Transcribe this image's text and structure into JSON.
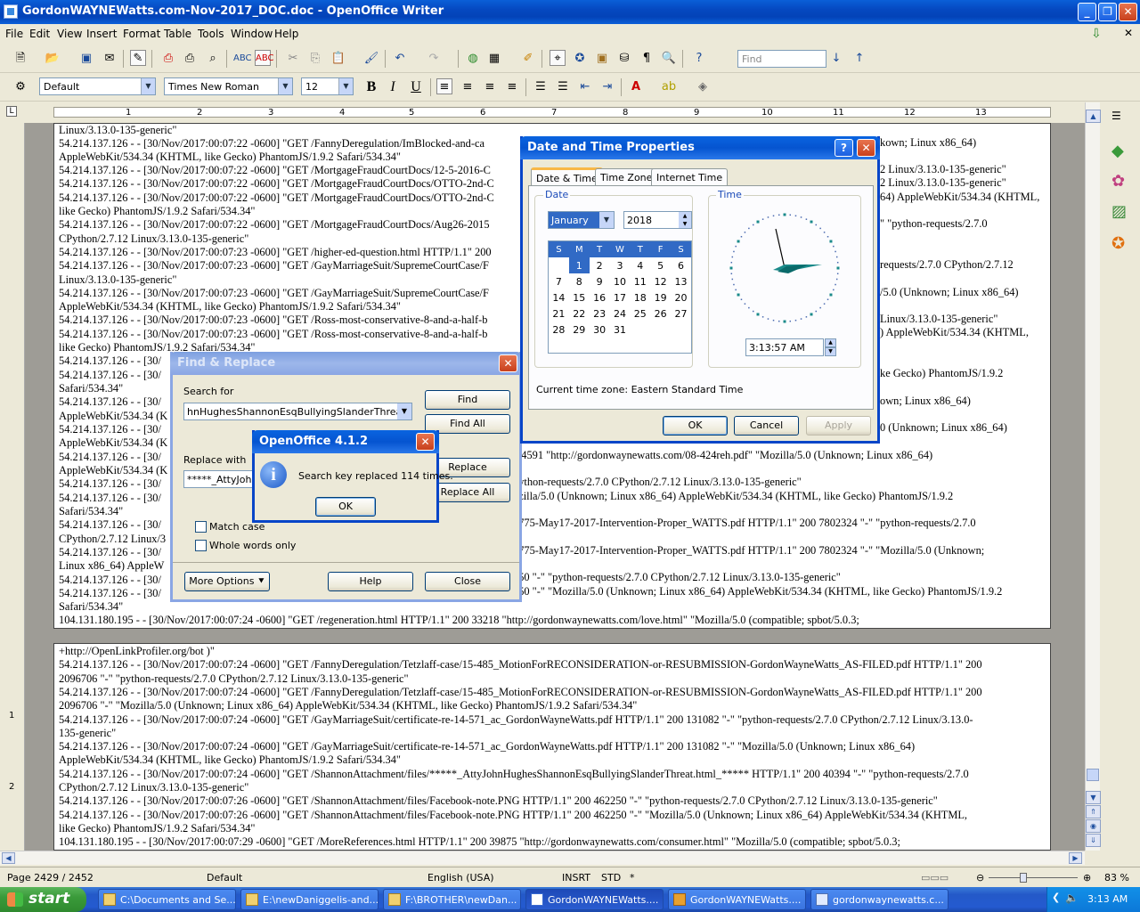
{
  "window": {
    "title": "GordonWAYNEWatts.com-Nov-2017_DOC.doc - OpenOffice Writer"
  },
  "menu": [
    "File",
    "Edit",
    "View",
    "Insert",
    "Format",
    "Table",
    "Tools",
    "Window",
    "Help"
  ],
  "toolbar": {
    "find_placeholder": "Find"
  },
  "format_bar": {
    "style": "Default",
    "font": "Times New Roman",
    "size": "12",
    "bold": "B",
    "italic": "I",
    "underline": "U"
  },
  "ruler": {
    "numbers": [
      "1",
      "2",
      "3",
      "4",
      "5",
      "6",
      "7",
      "8",
      "9",
      "10",
      "11",
      "12",
      "13"
    ]
  },
  "document": {
    "page1_lines": [
      "Linux/3.13.0-135-generic\"",
      "54.214.137.126 - - [30/Nov/2017:00:07:22 -0600] \"GET /FannyDeregulation/ImBlocked-and-ca",
      "AppleWebKit/534.34 (KHTML, like Gecko) PhantomJS/1.9.2 Safari/534.34\"",
      "54.214.137.126 - - [30/Nov/2017:00:07:22 -0600] \"GET /MortgageFraudCourtDocs/12-5-2016-C",
      "54.214.137.126 - - [30/Nov/2017:00:07:22 -0600] \"GET /MortgageFraudCourtDocs/OTTO-2nd-C",
      "54.214.137.126 - - [30/Nov/2017:00:07:22 -0600] \"GET /MortgageFraudCourtDocs/OTTO-2nd-C",
      "like Gecko) PhantomJS/1.9.2 Safari/534.34\"",
      "54.214.137.126 - - [30/Nov/2017:00:07:22 -0600] \"GET /MortgageFraudCourtDocs/Aug26-2015",
      "CPython/2.7.12 Linux/3.13.0-135-generic\"",
      "54.214.137.126 - - [30/Nov/2017:00:07:23 -0600] \"GET /higher-ed-question.html HTTP/1.1\" 200",
      "54.214.137.126 - - [30/Nov/2017:00:07:23 -0600] \"GET /GayMarriageSuit/SupremeCourtCase/F",
      "Linux/3.13.0-135-generic\"",
      "54.214.137.126 - - [30/Nov/2017:00:07:23 -0600] \"GET /GayMarriageSuit/SupremeCourtCase/F",
      "AppleWebKit/534.34 (KHTML, like Gecko) PhantomJS/1.9.2 Safari/534.34\"",
      "54.214.137.126 - - [30/Nov/2017:00:07:23 -0600] \"GET /Ross-most-conservative-8-and-a-half-b",
      "54.214.137.126 - - [30/Nov/2017:00:07:23 -0600] \"GET /Ross-most-conservative-8-and-a-half-b",
      "like Gecko) PhantomJS/1.9.2 Safari/534.34\"",
      "54.214.137.126 - - [30/",
      "54.214.137.126 - - [30/",
      "Safari/534.34\"",
      "54.214.137.126 - - [30/",
      "AppleWebKit/534.34 (K",
      "54.214.137.126 - - [30/",
      "AppleWebKit/534.34 (K",
      "54.214.137.126 - - [30/",
      "AppleWebKit/534.34 (K",
      "54.214.137.126 - - [30/",
      "54.214.137.126 - - [30/",
      "Safari/534.34\"",
      "54.214.137.126 - - [30/",
      "CPython/2.7.12 Linux/3",
      "54.214.137.126 - - [30/",
      "Linux x86_64) AppleW",
      "54.214.137.126 - - [30/",
      "54.214.137.126 - - [30/",
      "Safari/534.34\"",
      "104.131.180.195 - - [30/Nov/2017:00:07:24 -0600] \"GET /regeneration.html HTTP/1.1\" 200 33218 \"http://gordonwaynewatts.com/love.html\" \"Mozilla/5.0 (compatible; spbot/5.0.3;"
    ],
    "page1_right": [
      [
        "kown; Linux x86_64)",
        160
      ],
      [
        "2 Linux/3.13.0-135-generic\"",
        190
      ],
      [
        "2 Linux/3.13.0-135-generic\"",
        205
      ],
      [
        "64) AppleWebKit/534.34 (KHTML,",
        221
      ],
      [
        "\" \"python-requests/2.7.0",
        251
      ],
      [
        "requests/2.7.0 CPython/2.7.12",
        297
      ],
      [
        "/5.0 (Unknown; Linux x86_64)",
        328
      ],
      [
        "Linux/3.13.0-135-generic\"",
        358
      ],
      [
        ") AppleWebKit/534.34 (KHTML,",
        373
      ],
      [
        "ke Gecko) PhantomJS/1.9.2",
        419
      ],
      [
        "own; Linux x86_64)",
        450
      ],
      [
        "0 (Unknown; Linux x86_64)",
        480
      ]
    ],
    "page1_mid": [
      [
        "0 4591 \"http://gordonwaynewatts.com/08-424reh.pdf\" \"Mozilla/5.0 (Unknown; Linux x86_64)",
        511
      ],
      [
        "python-requests/2.7.0 CPython/2.7.12 Linux/3.13.0-135-generic\"",
        541
      ],
      [
        "ozilla/5.0 (Unknown; Linux x86_64) AppleWebKit/534.34 (KHTML, like Gecko) PhantomJS/1.9.2",
        557
      ],
      [
        "0775-May17-2017-Intervention-Proper_WATTS.pdf HTTP/1.1\" 200 7802324 \"-\" \"python-requests/2.7.0",
        587
      ],
      [
        "0775-May17-2017-Intervention-Proper_WATTS.pdf HTTP/1.1\" 200 7802324 \"-\" \"Mozilla/5.0 (Unknown;",
        618
      ],
      [
        "250 \"-\" \"python-requests/2.7.0 CPython/2.7.12 Linux/3.13.0-135-generic\"",
        648
      ],
      [
        "250 \"-\" \"Mozilla/5.0 (Unknown; Linux x86_64) AppleWebKit/534.34 (KHTML, like Gecko) PhantomJS/1.9.2",
        664
      ]
    ],
    "page2_lines": [
      "+http://OpenLinkProfiler.org/bot )\"",
      "54.214.137.126 - - [30/Nov/2017:00:07:24 -0600] \"GET /FannyDeregulation/Tetzlaff-case/15-485_MotionForRECONSIDERATION-or-RESUBMISSION-GordonWayneWatts_AS-FILED.pdf HTTP/1.1\" 200",
      "2096706 \"-\" \"python-requests/2.7.0 CPython/2.7.12 Linux/3.13.0-135-generic\"",
      "54.214.137.126 - - [30/Nov/2017:00:07:24 -0600] \"GET /FannyDeregulation/Tetzlaff-case/15-485_MotionForRECONSIDERATION-or-RESUBMISSION-GordonWayneWatts_AS-FILED.pdf HTTP/1.1\" 200",
      "2096706 \"-\" \"Mozilla/5.0 (Unknown; Linux x86_64) AppleWebKit/534.34 (KHTML, like Gecko) PhantomJS/1.9.2 Safari/534.34\"",
      "54.214.137.126 - - [30/Nov/2017:00:07:24 -0600] \"GET /GayMarriageSuit/certificate-re-14-571_ac_GordonWayneWatts.pdf HTTP/1.1\" 200 131082 \"-\" \"python-requests/2.7.0 CPython/2.7.12 Linux/3.13.0-",
      "135-generic\"",
      "54.214.137.126 - - [30/Nov/2017:00:07:24 -0600] \"GET /GayMarriageSuit/certificate-re-14-571_ac_GordonWayneWatts.pdf HTTP/1.1\" 200 131082 \"-\" \"Mozilla/5.0 (Unknown; Linux x86_64)",
      "AppleWebKit/534.34 (KHTML, like Gecko) PhantomJS/1.9.2 Safari/534.34\"",
      "54.214.137.126 - - [30/Nov/2017:00:07:24 -0600] \"GET /ShannonAttachment/files/*****_AttyJohnHughesShannonEsqBullyingSlanderThreat.html_***** HTTP/1.1\" 200 40394 \"-\" \"python-requests/2.7.0",
      "CPython/2.7.12 Linux/3.13.0-135-generic\"",
      "54.214.137.126 - - [30/Nov/2017:00:07:26 -0600] \"GET /ShannonAttachment/files/Facebook-note.PNG HTTP/1.1\" 200 462250 \"-\" \"python-requests/2.7.0 CPython/2.7.12 Linux/3.13.0-135-generic\"",
      "54.214.137.126 - - [30/Nov/2017:00:07:26 -0600] \"GET /ShannonAttachment/files/Facebook-note.PNG HTTP/1.1\" 200 462250 \"-\" \"Mozilla/5.0 (Unknown; Linux x86_64) AppleWebKit/534.34 (KHTML,",
      "like Gecko) PhantomJS/1.9.2 Safari/534.34\"",
      "104.131.180.195 - - [30/Nov/2017:00:07:29 -0600] \"GET /MoreReferences.html HTTP/1.1\" 200 39875 \"http://gordonwaynewatts.com/consumer.html\" \"Mozilla/5.0 (compatible; spbot/5.0.3;"
    ]
  },
  "find_replace": {
    "title": "Find & Replace",
    "search_label": "Search for",
    "search_value": "hnHughesShannonEsqBullyingSlanderThreat.html",
    "replace_label": "Replace with",
    "replace_value": "*****_AttyJoh",
    "find_btn": "Find",
    "find_all_btn": "Find All",
    "replace_btn": "Replace",
    "replace_all_btn": "Replace All",
    "match_case": "Match case",
    "whole_words": "Whole words only",
    "more_options": "More Options",
    "help_btn": "Help",
    "close_btn": "Close"
  },
  "message": {
    "title": "OpenOffice 4.1.2",
    "text": "Search key replaced 114 times.",
    "ok": "OK"
  },
  "datetime": {
    "title": "Date and Time Properties",
    "tabs": [
      "Date & Time",
      "Time Zone",
      "Internet Time"
    ],
    "date_group": "Date",
    "time_group": "Time",
    "month": "January",
    "year": "2018",
    "day_headers": [
      "S",
      "M",
      "T",
      "W",
      "T",
      "F",
      "S"
    ],
    "weeks": [
      [
        "",
        "1",
        "2",
        "3",
        "4",
        "5",
        "6"
      ],
      [
        "7",
        "8",
        "9",
        "10",
        "11",
        "12",
        "13"
      ],
      [
        "14",
        "15",
        "16",
        "17",
        "18",
        "19",
        "20"
      ],
      [
        "21",
        "22",
        "23",
        "24",
        "25",
        "26",
        "27"
      ],
      [
        "28",
        "29",
        "30",
        "31",
        "",
        "",
        ""
      ]
    ],
    "selected_day": "1",
    "time": "3:13:57 AM",
    "timezone_text": "Current time zone:  Eastern Standard Time",
    "ok": "OK",
    "cancel": "Cancel",
    "apply": "Apply"
  },
  "status": {
    "page": "Page 2429 / 2452",
    "style": "Default",
    "language": "English (USA)",
    "insert": "INSRT",
    "std": "STD",
    "modified": "*",
    "zoom": "83 %"
  },
  "taskbar": {
    "start": "start",
    "tasks": [
      "C:\\Documents and Se...",
      "E:\\newDaniggelis-and...",
      "F:\\BROTHER\\newDan...",
      "GordonWAYNEWatts....",
      "GordonWAYNEWatts....",
      "gordonwaynewatts.c..."
    ],
    "clock": "3:13 AM"
  }
}
